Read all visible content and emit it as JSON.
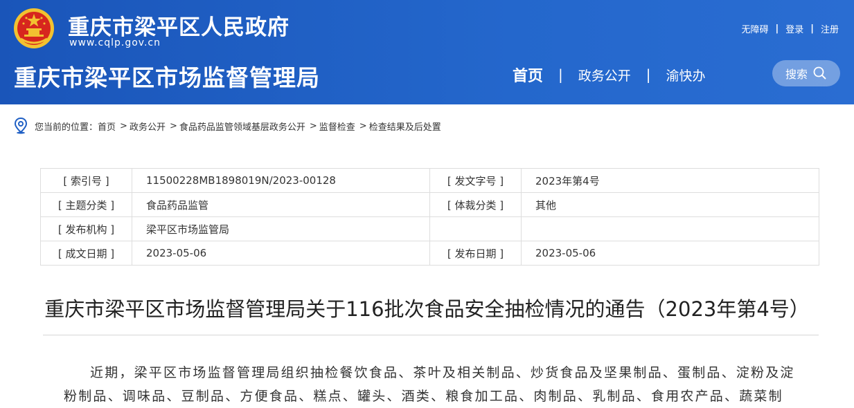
{
  "header": {
    "gov_name": "重庆市梁平区人民政府",
    "gov_url": "www.cqlp.gov.cn",
    "dept_name": "重庆市梁平区市场监督管理局",
    "top_links": [
      "无障碍",
      "登录",
      "注册"
    ],
    "nav": [
      "首页",
      "政务公开",
      "渝快办"
    ],
    "search_label": "搜索"
  },
  "breadcrumb": {
    "prefix": "您当前的位置：",
    "items": [
      "首页",
      "政务公开",
      "食品药品监管领域基层政务公开",
      "监督检查",
      "检查结果及后处置"
    ],
    "separator": ">"
  },
  "info": {
    "rows": [
      {
        "label1": "[ 索引号 ]",
        "value1": "11500228MB1898019N/2023-00128",
        "label2": "[ 发文字号 ]",
        "value2": "2023年第4号"
      },
      {
        "label1": "[ 主题分类 ]",
        "value1": "食品药品监管",
        "label2": "[ 体裁分类 ]",
        "value2": "其他"
      },
      {
        "label1": "[ 发布机构 ]",
        "value1": "梁平区市场监管局",
        "label2": "",
        "value2": ""
      },
      {
        "label1": "[ 成文日期 ]",
        "value1": "2023-05-06",
        "label2": "[ 发布日期 ]",
        "value2": "2023-05-06"
      }
    ]
  },
  "article": {
    "title": "重庆市梁平区市场监督管理局关于116批次食品安全抽检情况的通告（2023年第4号）",
    "paragraph": "近期，梁平区市场监督管理局组织抽检餐饮食品、茶叶及相关制品、炒货食品及坚果制品、蛋制品、淀粉及淀粉制品、调味品、豆制品、方便食品、糕点、罐头、酒类、粮食加工品、肉制品、乳制品、食用农产品、蔬菜制"
  },
  "colors": {
    "header_bg": "#1f5fc4",
    "text": "#333333",
    "border": "#dddddd"
  }
}
